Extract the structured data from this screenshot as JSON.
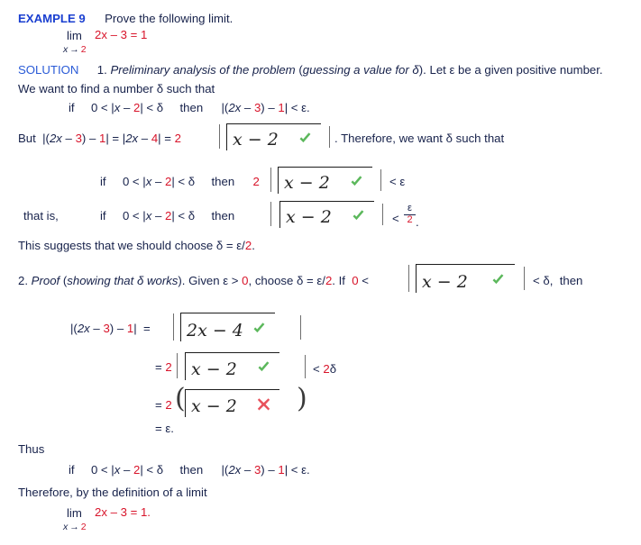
{
  "document": {
    "title": "EXAMPLE 9 — Prove the following limit (epsilon-delta proof worksheet)",
    "colors": {
      "heading_blue": "#1a3fd0",
      "solution_blue": "#2a5bd7",
      "body_navy": "#17224b",
      "number_red": "#d8142a",
      "correct_green": "#5cb85c",
      "incorrect_red": "#e8525c",
      "box_border": "#1c1c1c"
    }
  },
  "example": {
    "label": "EXAMPLE 9",
    "prompt": "Prove the following limit."
  },
  "limit_statement": {
    "lim": "lim",
    "subscript_var": "x",
    "subscript_arrow": "→",
    "subscript_value": "2",
    "expression": "2x – 3 = 1"
  },
  "solution": {
    "label": "SOLUTION",
    "part1_line1_a": "1. ",
    "part1_line1_b": "Preliminary analysis of the problem",
    "part1_line1_c": " (",
    "part1_line1_d": "guessing a value for δ",
    "part1_line1_e": "). Let ε be a given positive number.",
    "part1_line2": "We want to find a number δ such that",
    "cond_if": "if",
    "cond_left": "0 < |x – 2| < δ",
    "cond_then": "then",
    "cond_right": "|(2x – 3) – 1| < ε.",
    "but_line": "But  |(2x – 3) – 1| = |2x – 4| = 2",
    "therefore_line": ". Therefore, we want δ such that",
    "less_eps": "< ε",
    "that_is": "that is,",
    "coefficient_2": "2",
    "suggest_line": "This suggests that we should choose δ = ε/2.",
    "frac_num": "ε",
    "frac_den": "2",
    "frac_period": "."
  },
  "proof": {
    "part2_a": "2. ",
    "part2_b": "Proof",
    "part2_c": " (",
    "part2_d": "showing that δ works",
    "part2_e": "). Given ε > 0, choose δ = ε/2. If  0 <",
    "part2_tail": "< δ,  then",
    "eq_lhs": "|(2x – 3) – 1|  =",
    "eq_2": "= 2",
    "lt_2delta": "< 2δ",
    "eq_2paren": "= 2",
    "paren_open": "(",
    "paren_close": ")",
    "eq_eps": "= ε.",
    "thus": "Thus",
    "thus_if": "if",
    "thus_left": "0 < |x – 2| < δ",
    "thus_then": "then",
    "thus_right": "|(2x – 3) – 1| < ε.",
    "therefore_def": "Therefore, by the definition of a limit",
    "final_limit_expr": "2x – 3 = 1."
  },
  "answer_boxes": [
    {
      "id": "box1",
      "value": "x − 2",
      "status": "correct",
      "mark": "check-icon"
    },
    {
      "id": "box2",
      "value": "x − 2",
      "status": "correct",
      "mark": "check-icon"
    },
    {
      "id": "box3",
      "value": "x − 2",
      "status": "correct",
      "mark": "check-icon"
    },
    {
      "id": "box4",
      "value": "x − 2",
      "status": "correct",
      "mark": "check-icon"
    },
    {
      "id": "box5",
      "value": "2x − 4",
      "status": "correct",
      "mark": "check-icon"
    },
    {
      "id": "box6",
      "value": "x − 2",
      "status": "correct",
      "mark": "check-icon"
    },
    {
      "id": "box7",
      "value": "x − 2",
      "status": "incorrect",
      "mark": "cross-icon"
    }
  ]
}
